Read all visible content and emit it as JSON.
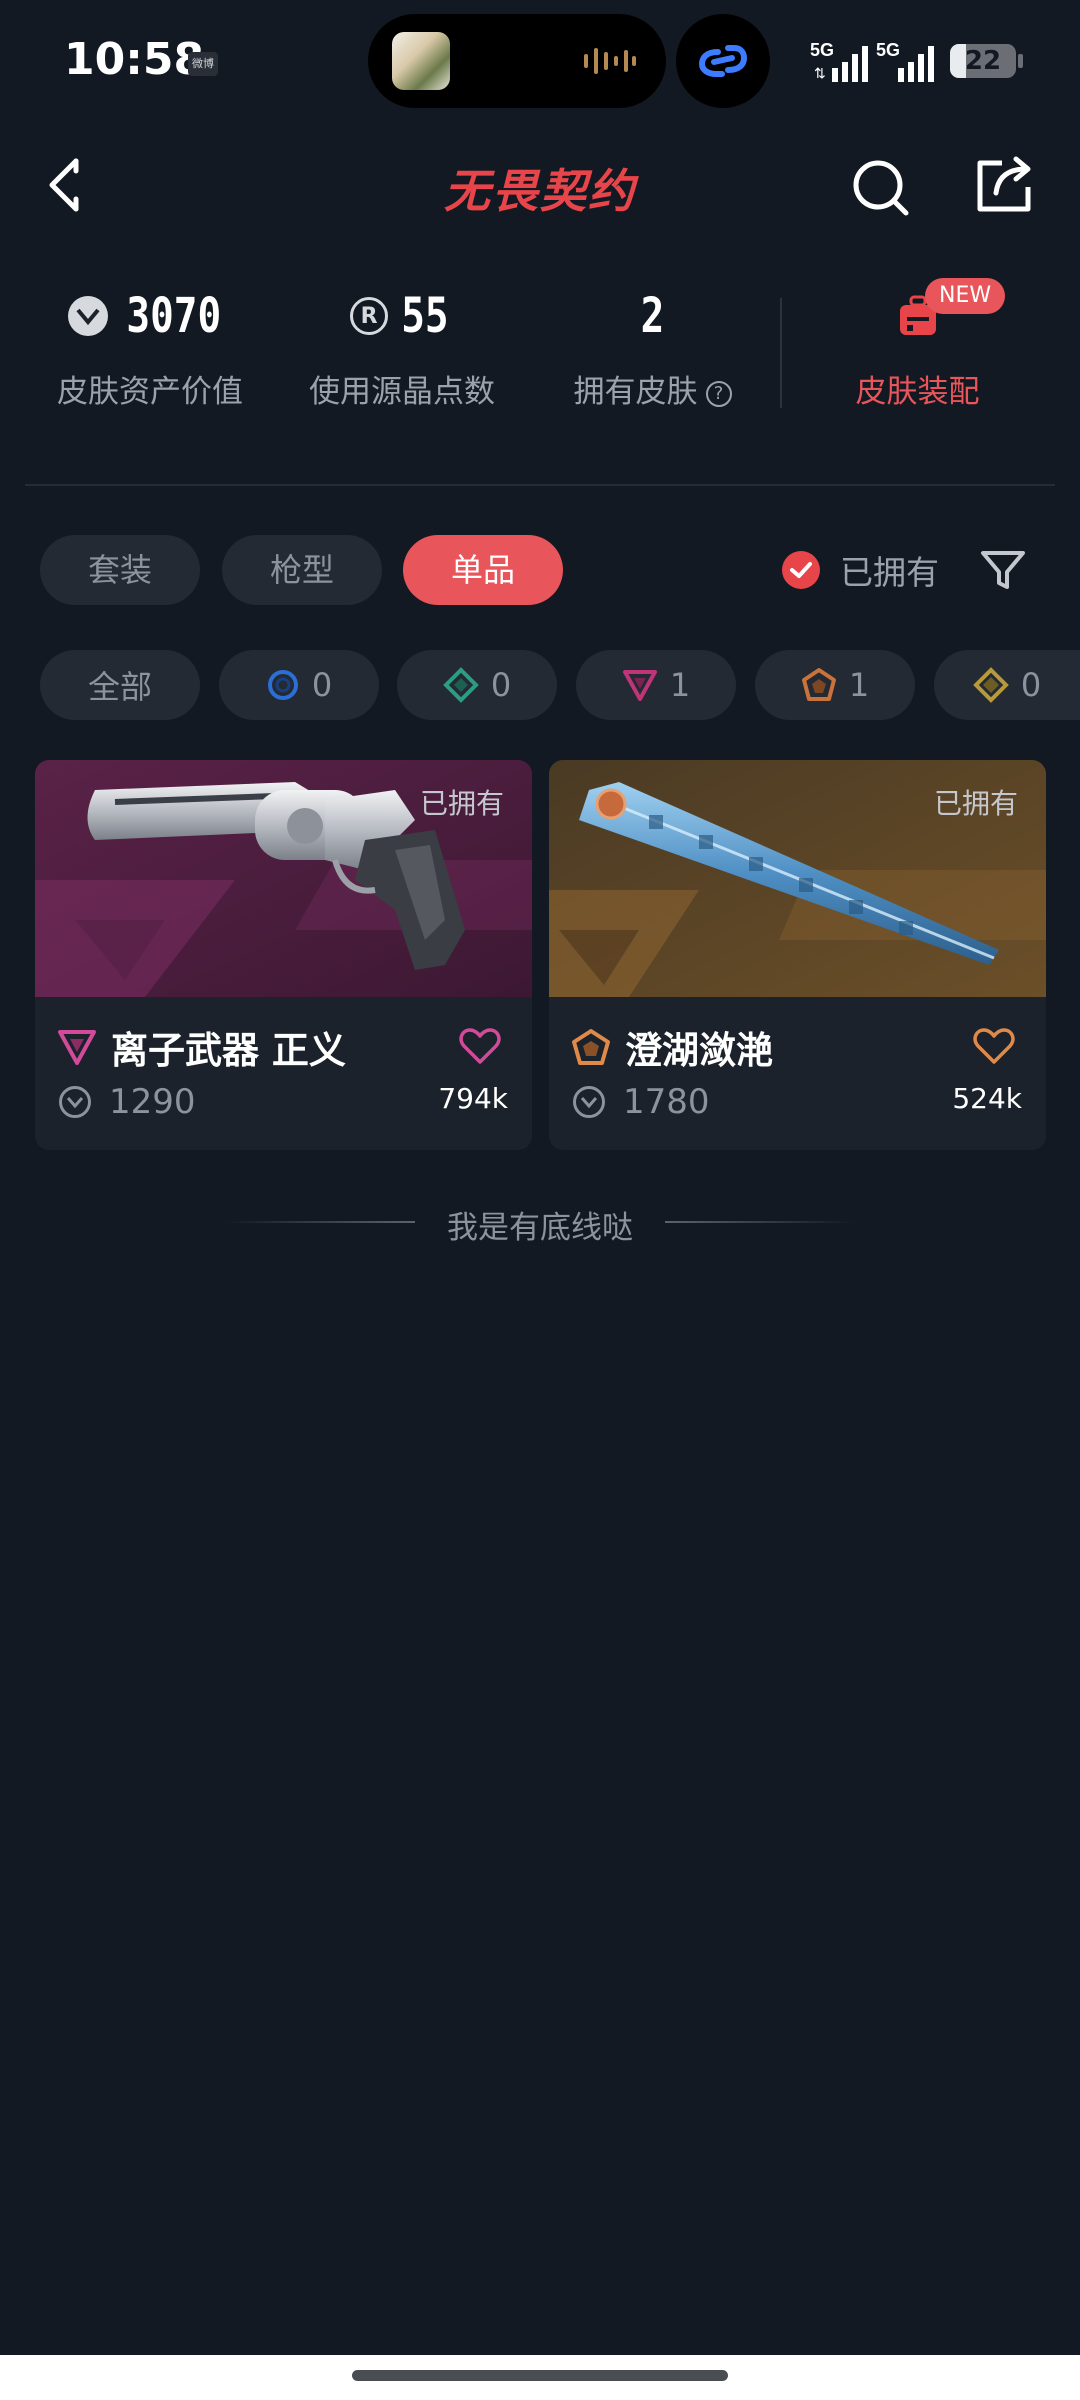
{
  "status_bar": {
    "time": "10:58",
    "notification_icon_text": "微博",
    "signal1_label": "5G",
    "signal2_label": "5G",
    "battery": "22"
  },
  "header": {
    "title": "无畏契约"
  },
  "stats": {
    "asset_value": "3070",
    "asset_value_label": "皮肤资产价值",
    "radianite": "55",
    "radianite_label": "使用源晶点数",
    "skins_owned": "2",
    "skins_owned_label": "拥有皮肤",
    "help_glyph": "?",
    "equip_label": "皮肤装配",
    "new_badge": "NEW"
  },
  "tabs": [
    {
      "label": "套装",
      "active": false
    },
    {
      "label": "枪型",
      "active": false
    },
    {
      "label": "单品",
      "active": true
    }
  ],
  "owned_filter": {
    "label": "已拥有",
    "checked": true
  },
  "rarity_chips": [
    {
      "label": "全部"
    },
    {
      "icon": "select-tier-icon",
      "count": "0",
      "color": "#2b6fd6"
    },
    {
      "icon": "deluxe-tier-icon",
      "count": "0",
      "color": "#2a9d82"
    },
    {
      "icon": "premium-tier-icon",
      "count": "1",
      "color": "#c0357a"
    },
    {
      "icon": "exclusive-tier-icon",
      "count": "1",
      "color": "#c9733b"
    },
    {
      "icon": "ultra-tier-icon",
      "count": "0",
      "color": "#b89a3a"
    }
  ],
  "cards": [
    {
      "name": "离子武器 正义",
      "owned_label": "已拥有",
      "price": "1290",
      "likes": "794k",
      "tier_icon": "premium-tier-icon",
      "tier_color": "#d24a9a",
      "heart_color": "#d24a9a",
      "image_icon": "revolver-skin-icon"
    },
    {
      "name": "澄湖潋滟",
      "owned_label": "已拥有",
      "price": "1780",
      "likes": "524k",
      "tier_icon": "exclusive-tier-icon",
      "tier_color": "#e08a4a",
      "heart_color": "#e08a4a",
      "image_icon": "melee-fan-skin-icon"
    }
  ],
  "end_of_list": "我是有底线哒",
  "colors": {
    "background": "#121922",
    "accent": "#e8555a",
    "surface": "#1b222b",
    "chip": "#232a33"
  }
}
